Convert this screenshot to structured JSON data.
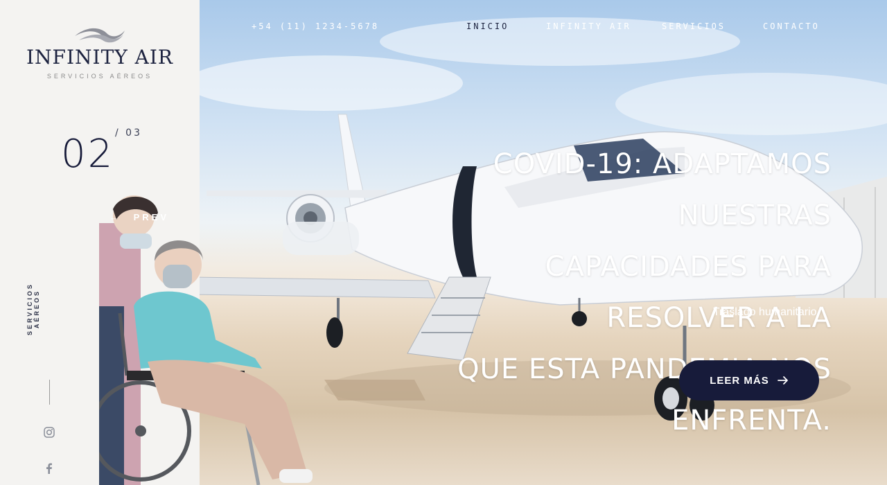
{
  "brand": {
    "name": "INFINITY AIR",
    "tagline": "SERVICIOS AÉREOS"
  },
  "nav": {
    "phone": "+54 (11) 1234-5678",
    "items": [
      "INICIO",
      "INFINITY AIR",
      "SERVICIOS",
      "CONTACTO"
    ],
    "active": "INICIO"
  },
  "slider": {
    "current": "02",
    "total": "/ 03",
    "prev_label": "PREV"
  },
  "side": {
    "vertical_label": "SERVICIOS AÉREOS",
    "social_icons": [
      "instagram-icon",
      "facebook-icon"
    ]
  },
  "hero": {
    "headline_lines": [
      "COVID-19: ADAPTAMOS NUESTRAS",
      "CAPACIDADES PARA RESOLVER A LA",
      "QUE ESTA PANDEMIA NOS ENFRENTA."
    ],
    "subtitle": "Traslado humanitario.",
    "cta_label": "LEER MÁS"
  },
  "colors": {
    "navy": "#171b3a",
    "panel": "#f4f3f1",
    "white": "#ffffff"
  }
}
